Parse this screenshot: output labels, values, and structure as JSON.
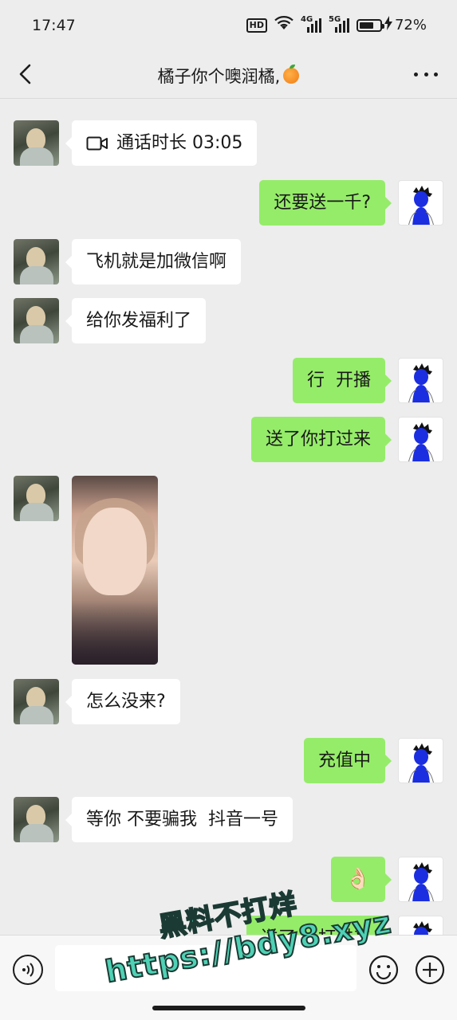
{
  "status": {
    "time": "17:47",
    "hd_label": "HD",
    "net1_label": "4G",
    "net2_label": "5G",
    "battery_level": 0.72,
    "battery_text": "72%"
  },
  "header": {
    "title": "橘子你个噢润橘,",
    "title_emoji": "orange-icon"
  },
  "messages": [
    {
      "side": "left",
      "kind": "call",
      "text": "通话时长 03:05"
    },
    {
      "side": "right",
      "kind": "text",
      "text": "还要送一千?"
    },
    {
      "side": "left",
      "kind": "text",
      "text": "飞机就是加微信啊"
    },
    {
      "side": "left",
      "kind": "text",
      "text": "给你发福利了"
    },
    {
      "side": "right",
      "kind": "text",
      "text": "行  开播"
    },
    {
      "side": "right",
      "kind": "text",
      "text": "送了你打过来"
    },
    {
      "side": "left",
      "kind": "image",
      "text": ""
    },
    {
      "side": "left",
      "kind": "text",
      "text": "怎么没来?"
    },
    {
      "side": "right",
      "kind": "text",
      "text": "充值中"
    },
    {
      "side": "left",
      "kind": "text",
      "text": "等你 不要骗我  抖音一号"
    },
    {
      "side": "right",
      "kind": "emoji",
      "text": "👌🏻"
    },
    {
      "side": "right",
      "kind": "text",
      "text": "送了... 打过来"
    }
  ],
  "input": {
    "placeholder": ""
  },
  "watermark": {
    "line1": "黑料不打烊",
    "line2": "https://bdy8.xyz"
  },
  "colors": {
    "background": "#ededed",
    "sent_bubble": "#95ec69",
    "received_bubble": "#ffffff"
  }
}
